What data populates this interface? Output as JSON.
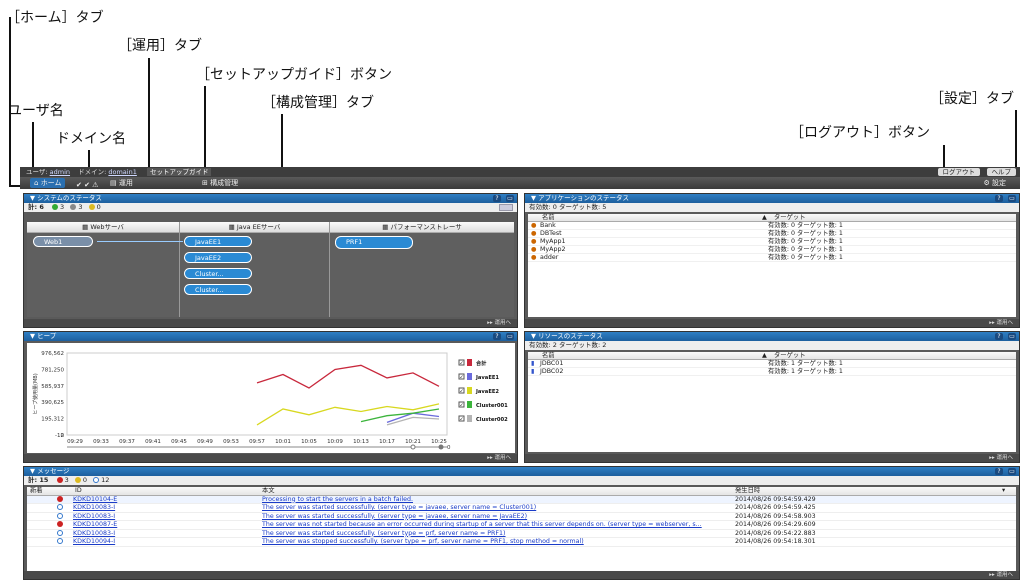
{
  "callouts": {
    "home_tab": "［ホーム］タブ",
    "ops_tab": "［運用］タブ",
    "setup_btn": "［セットアップガイド］ボタン",
    "config_tab": "［構成管理］タブ",
    "user": "ユーザ名",
    "domain": "ドメイン名",
    "settings_tab": "［設定］タブ",
    "logout_btn": "［ログアウト］ボタン"
  },
  "topbar": {
    "user_label": "ユーザ:",
    "user": "admin",
    "domain_label": "ドメイン:",
    "domain": "domain1",
    "setup": "セットアップガイド",
    "logout": "ログアウト",
    "help": "ヘルプ"
  },
  "tabs": {
    "home": "ホーム",
    "ops": "運用",
    "config": "構成管理",
    "settings": "設定"
  },
  "sysstatus": {
    "title": "システムのステータス",
    "total": "計: 6",
    "ok": "3",
    "gray": "3",
    "warn": "0",
    "cols": [
      "Webサーバ",
      "Java EEサーバ",
      "パフォーマンストレーサ"
    ],
    "web": [
      "Web1"
    ],
    "java": [
      "JavaEE1",
      "JavaEE2",
      "Cluster...",
      "Cluster..."
    ],
    "prf": [
      "PRF1"
    ],
    "footer": "運用へ"
  },
  "appstatus": {
    "title": "アプリケーションのステータス",
    "summary": "有効数: 0  ターゲット数: 5",
    "col_name": "名前",
    "col_target": "ターゲット",
    "rows": [
      {
        "name": "Bank",
        "target": "有効数: 0  ターゲット数: 1"
      },
      {
        "name": "DBTest",
        "target": "有効数: 0  ターゲット数: 1"
      },
      {
        "name": "MyApp1",
        "target": "有効数: 0  ターゲット数: 1"
      },
      {
        "name": "MyApp2",
        "target": "有効数: 0  ターゲット数: 1"
      },
      {
        "name": "adder",
        "target": "有効数: 0  ターゲット数: 1"
      }
    ],
    "footer": "運用へ"
  },
  "heap": {
    "title": "ヒープ",
    "ylabel": "ヒープ使用量(MB)",
    "footer": "運用へ"
  },
  "chart_data": {
    "type": "line",
    "x": [
      "09:29",
      "09:33",
      "09:37",
      "09:41",
      "09:45",
      "09:49",
      "09:53",
      "09:57",
      "10:01",
      "10:05",
      "10:09",
      "10:13",
      "10:17",
      "10:21",
      "10:25"
    ],
    "y_ticks": [
      "976,562",
      "781,250",
      "585,937",
      "390,625",
      "195,312",
      "0",
      "-12"
    ],
    "ylim": [
      -12,
      976562
    ],
    "series": [
      {
        "name": "合計",
        "color": "#c8283c",
        "values": [
          null,
          null,
          null,
          null,
          null,
          null,
          null,
          620000,
          720000,
          560000,
          780000,
          830000,
          680000,
          740000,
          580000
        ]
      },
      {
        "name": "JavaEE1",
        "color": "#6a6adc",
        "values": [
          null,
          null,
          null,
          null,
          null,
          null,
          null,
          null,
          null,
          null,
          null,
          null,
          150000,
          260000,
          220000
        ]
      },
      {
        "name": "JavaEE2",
        "color": "#d8d820",
        "values": [
          null,
          null,
          null,
          null,
          null,
          null,
          null,
          120000,
          310000,
          240000,
          330000,
          280000,
          340000,
          300000,
          370000
        ]
      },
      {
        "name": "Cluster001",
        "color": "#3cb43c",
        "values": [
          null,
          null,
          null,
          null,
          null,
          null,
          null,
          null,
          null,
          null,
          null,
          160000,
          230000,
          260000,
          310000
        ]
      },
      {
        "name": "Cluster002",
        "color": "#b4b4b4",
        "values": [
          null,
          null,
          null,
          null,
          null,
          null,
          null,
          null,
          null,
          null,
          null,
          null,
          120000,
          210000,
          190000
        ]
      }
    ],
    "slider_end": "0"
  },
  "resstatus": {
    "title": "リソースのステータス",
    "summary": "有効数: 2  ターゲット数: 2",
    "col_name": "名前",
    "col_target": "ターゲット",
    "rows": [
      {
        "name": "JDBC01",
        "target": "有効数: 1  ターゲット数: 1"
      },
      {
        "name": "JDBC02",
        "target": "有効数: 1  ターゲット数: 1"
      }
    ],
    "footer": "運用へ"
  },
  "messages": {
    "title": "メッセージ",
    "total": "計: 15",
    "err": "3",
    "warn": "0",
    "info": "12",
    "cols": {
      "new": "新着",
      "id": "ID",
      "body": "本文",
      "date": "発生日時"
    },
    "rows": [
      {
        "type": "err",
        "id": "KDKD10104-E",
        "body": "Processing to start the servers in a batch failed.",
        "date": "2014/08/26 09:54:59.429"
      },
      {
        "type": "info",
        "id": "KDKD10083-I",
        "body": "The server was started successfully. (server type = javaee, server name = Cluster001)",
        "date": "2014/08/26 09:54:59.425"
      },
      {
        "type": "info",
        "id": "KDKD10083-I",
        "body": "The server was started successfully. (server type = javaee, server name = JavaEE2)",
        "date": "2014/08/26 09:54:58.903"
      },
      {
        "type": "err",
        "id": "KDKD10087-E",
        "body": "The server was not started because an error occurred during startup of a server that this server depends on. (server type = webserver, s...",
        "date": "2014/08/26 09:54:29.609"
      },
      {
        "type": "info",
        "id": "KDKD10083-I",
        "body": "The server was started successfully. (server type = prf, server name = PRF1)",
        "date": "2014/08/26 09:54:22.883"
      },
      {
        "type": "info",
        "id": "KDKD10094-I",
        "body": "The server was stopped successfully. (server type = prf, server name = PRF1, stop method = normal)",
        "date": "2014/08/26 09:54:18.301"
      }
    ],
    "footer": "運用へ"
  }
}
